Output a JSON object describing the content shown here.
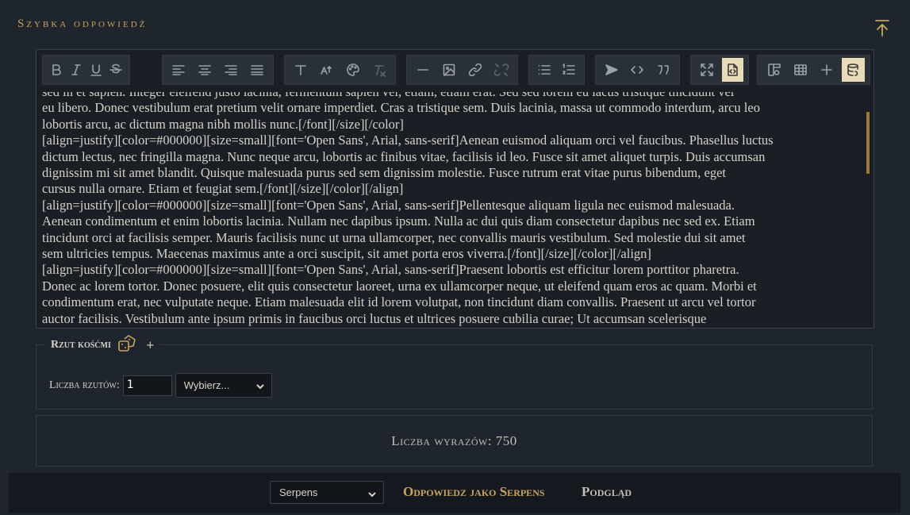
{
  "header": {
    "title": "Szybka odpowiedź",
    "top_icon": "arrow-up-to-top-icon"
  },
  "toolbar": {
    "groups": [
      [
        "bold-icon",
        "italic-icon",
        "underline-icon",
        "strikethrough-icon"
      ],
      [
        "align-left-icon",
        "align-center-icon",
        "align-right-icon",
        "align-justify-icon"
      ],
      [
        "font-icon",
        "font-size-icon",
        "palette-icon",
        "clear-format-icon"
      ],
      [
        "horizontal-rule-icon",
        "image-icon",
        "link-icon",
        "unlink-icon"
      ],
      [
        "bullet-list-icon",
        "ordered-list-icon"
      ],
      [
        "send-icon",
        "code-icon",
        "quote-icon"
      ],
      [
        "maximize-icon",
        "source-icon"
      ],
      [
        "template-icon",
        "table-icon",
        "plus-icon",
        "database-icon"
      ]
    ],
    "active": [
      "source-icon",
      "database-icon"
    ]
  },
  "editor": {
    "lines": [
      "sed in et sapien. Integer eleifend justo lacinia, fermentum sapien vel, etiam, etiam erat. Sed sed lorem eu lacus tristique tincidunt vel",
      "eu libero. Donec vestibulum erat pretium velit ornare imperdiet. Cras a tristique sem. Duis lacinia, massa ut commodo interdum, arcu leo",
      "lobortis arcu, ac dictum magna nibh mollis nunc.[/font][/size][/color]",
      "[align=justify][color=#000000][size=small][font='Open Sans', Arial, sans-serif]Aenean euismod aliquam orci vel faucibus. Phasellus luctus",
      "dictum lectus, nec fringilla magna. Nunc neque arcu, lobortis ac finibus vitae, facilisis id leo. Fusce sit amet aliquet turpis. Duis accumsan",
      "dignissim mi sit amet blandit. Quisque malesuada purus sed sem dignissim molestie. Fusce rutrum erat vitae purus bibendum, eget",
      "cursus nulla ornare. Etiam et feugiat sem.[/font][/size][/color][/align]",
      "[align=justify][color=#000000][size=small][font='Open Sans', Arial, sans-serif]Pellentesque aliquam ligula nec euismod malesuada.",
      "Aenean condimentum et enim lobortis lacinia. Nullam nec dapibus ipsum. Nulla ac dui quis diam consectetur dapibus nec sed ex. Etiam",
      "tincidunt orci at facilisis semper. Mauris facilisis nunc ut urna ullamcorper, nec convallis mauris vestibulum. Sed molestie dui sit amet",
      "sem ultricies tempus. Maecenas maximus ante a orci suscipit, sit amet porta eros viverra.[/font][/size][/color][/align]",
      "[align=justify][color=#000000][size=small][font='Open Sans', Arial, sans-serif]Praesent lobortis est efficitur lorem porttitor pharetra.",
      "Donec ac lorem tortor. Donec posuere, elit quis consectetur laoreet, urna ex ullamcorper neque, ut eleifend quam eros ac quam. Morbi et",
      "condimentum erat, nec vulputate neque. Etiam malesuada elit id lorem volutpat, non tincidunt diam convallis. Praesent ut arcu vel tortor",
      "auctor facilisis. Vestibulum ante ipsum primis in faucibus orci luctus et ultrices posuere cubilia curae; Ut accumsan scelerisque"
    ]
  },
  "dice": {
    "legend": "Rzut kośćmi",
    "legend_icon": "dice-icon",
    "add_label": "+",
    "count_label": "Liczba rzutów:",
    "count_value": "1",
    "select_value": "Wybierz..."
  },
  "word_count": "Liczba wyrazów: 750",
  "footer": {
    "character_select": "Serpens",
    "reply_label": "Odpowiedz jako Serpens",
    "preview_label": "Podgląd"
  },
  "colors": {
    "accent": "#c9a45c",
    "background": "#1f252d",
    "active_button": "#e8dcb8"
  }
}
